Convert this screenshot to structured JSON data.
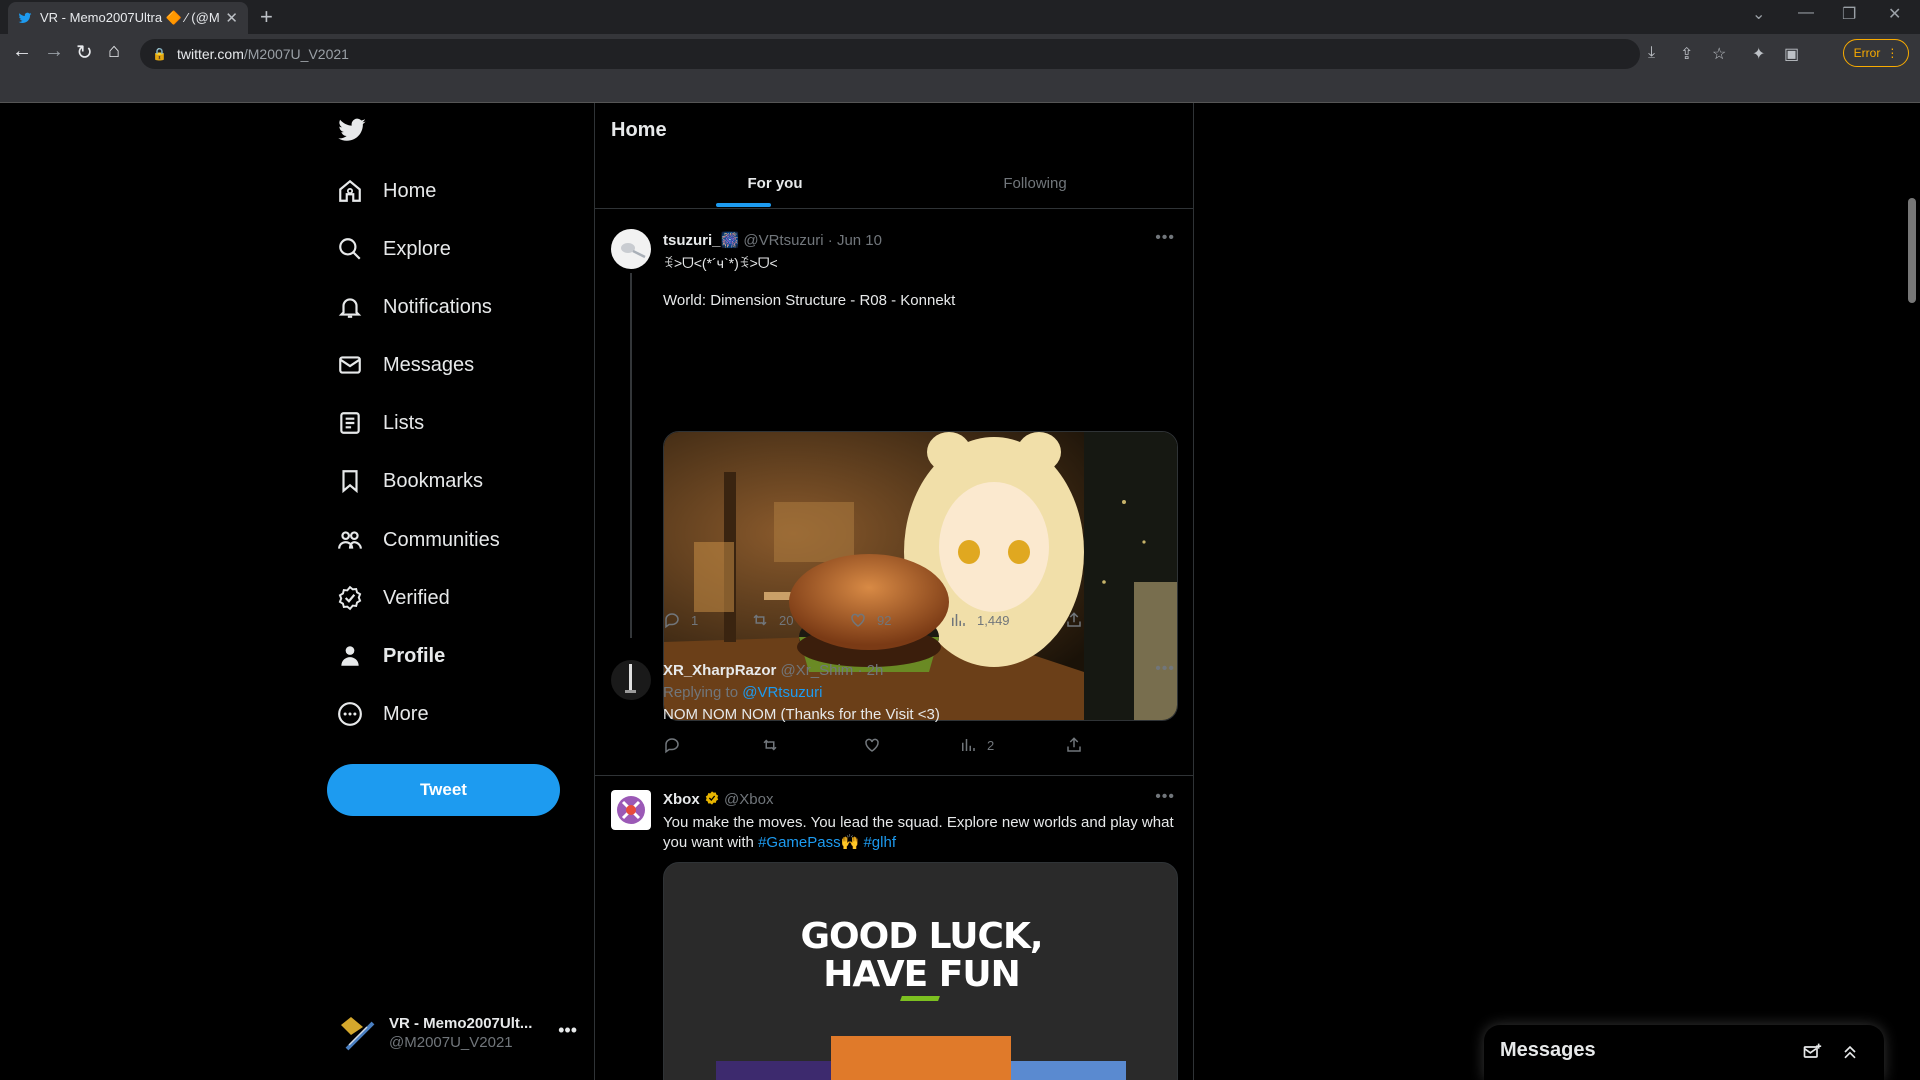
{
  "browser": {
    "tab_title": "VR - Memo2007Ultra 🔶 ⁄ (@M",
    "url_host": "twitter.com",
    "url_path": "/M2007U_V2021",
    "error_label": "Error"
  },
  "sidebar": {
    "items": [
      {
        "label": "Home",
        "icon": "home-icon"
      },
      {
        "label": "Explore",
        "icon": "search-icon"
      },
      {
        "label": "Notifications",
        "icon": "bell-icon"
      },
      {
        "label": "Messages",
        "icon": "envelope-icon"
      },
      {
        "label": "Lists",
        "icon": "list-icon"
      },
      {
        "label": "Bookmarks",
        "icon": "bookmark-icon"
      },
      {
        "label": "Communities",
        "icon": "people-icon"
      },
      {
        "label": "Verified",
        "icon": "verified-icon"
      },
      {
        "label": "Profile",
        "icon": "person-icon"
      },
      {
        "label": "More",
        "icon": "more-circle-icon"
      }
    ],
    "tweet_button": "Tweet",
    "account": {
      "name": "VR - Memo2007Ult...",
      "handle": "@M2007U_V2021"
    }
  },
  "timeline": {
    "title": "Home",
    "tabs": [
      "For you",
      "Following"
    ],
    "tweets": [
      {
        "name": "tsuzuri_🎆",
        "handle": "@VRtsuzuri",
        "time": "· Jun 10",
        "text1": "ꉂ˃ᗜ˂(*´ч`*)ꉂ˃ᗜ˂",
        "text2": "World: Dimension Structure - R08 - Konnekt",
        "replies": "1",
        "retweets": "20",
        "likes": "92",
        "views": "1,449"
      },
      {
        "name": "XR_XharpRazor",
        "handle": "@Xr_Shim",
        "time": "· 2h",
        "replying_prefix": "Replying to",
        "replying_to": "@VRtsuzuri",
        "text": "NOM NOM NOM (Thanks for the Visit <3)",
        "views": "2"
      },
      {
        "name": "Xbox",
        "handle": "@Xbox",
        "text_a": "You make the moves. You lead the squad. Explore new worlds and play what you want with",
        "hashtag1": "#GamePass",
        "emoji": "🙌",
        "hashtag2": "#glhf",
        "image_line1": "GOOD LUCK,",
        "image_line2": "HAVE FUN"
      }
    ]
  },
  "messages_drawer": {
    "title": "Messages"
  },
  "colors": {
    "accent": "#1d9bf0",
    "background": "#000000",
    "muted": "#71767b",
    "border": "#2f3336"
  }
}
